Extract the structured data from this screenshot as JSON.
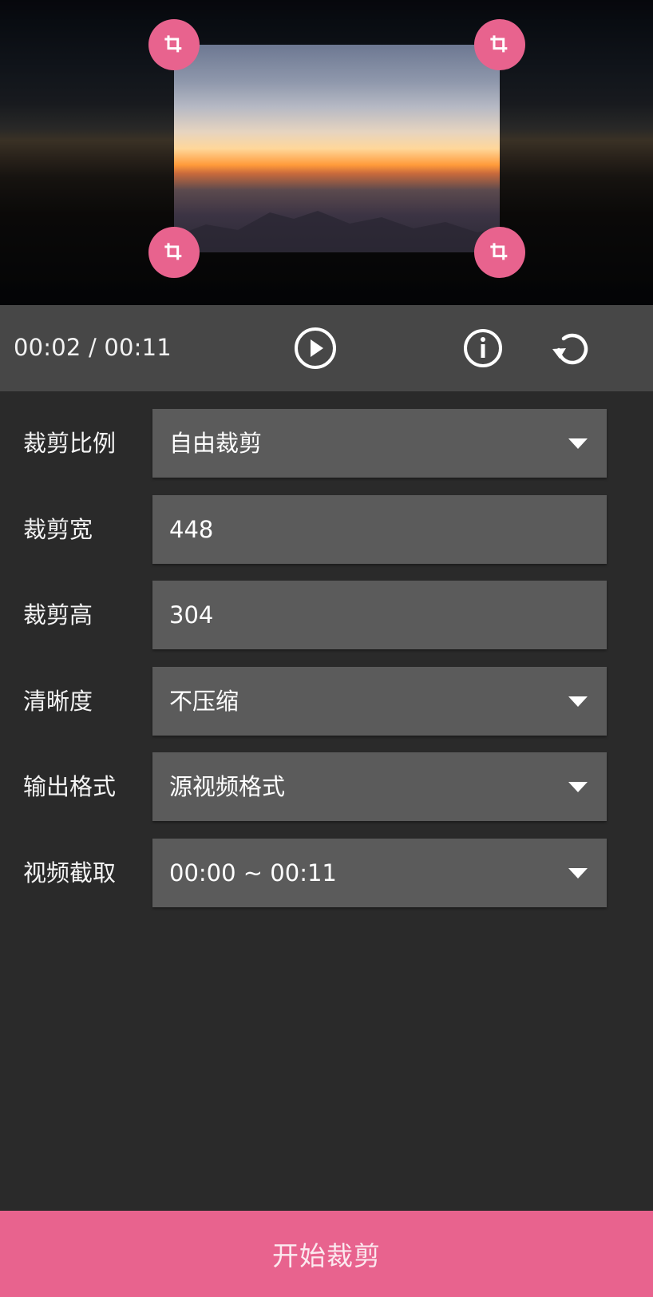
{
  "player": {
    "time_display": "00:02 / 00:11"
  },
  "icons": {
    "crop_handle": "crop-icon",
    "play": "play-circle-icon",
    "info": "info-circle-icon",
    "reset": "rotate-reset-icon",
    "dropdown": "caret-down-icon"
  },
  "form": {
    "ratio": {
      "label": "裁剪比例",
      "value": "自由裁剪"
    },
    "width": {
      "label": "裁剪宽",
      "value": "448"
    },
    "height": {
      "label": "裁剪高",
      "value": "304"
    },
    "quality": {
      "label": "清晰度",
      "value": "不压缩"
    },
    "format": {
      "label": "输出格式",
      "value": "源视频格式"
    },
    "clip": {
      "label": "视频截取",
      "value": "00:00 ~ 00:11"
    }
  },
  "actions": {
    "start_label": "开始裁剪"
  },
  "colors": {
    "accent": "#e8638e",
    "panel": "#474747",
    "background": "#2a2a2a",
    "field": "#5b5b5b"
  }
}
